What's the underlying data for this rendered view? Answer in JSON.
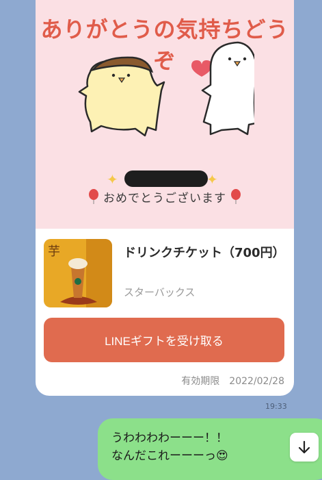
{
  "banner": {
    "title": "ありがとうの気持ちどうぞ",
    "congrats": "おめでとうございます"
  },
  "product": {
    "title": "ドリンクチケット（700円）",
    "brand": "スターバックス",
    "thumb_kanji": "芋"
  },
  "gift_button": {
    "label": "LINEギフトを受け取る"
  },
  "expiry": {
    "label": "有効期限",
    "date": "2022/02/28"
  },
  "chat": {
    "time": "19:33",
    "message_line1": "うわわわわーーー！！",
    "message_line2": "なんだこれーーーっ😍"
  },
  "colors": {
    "background": "#8ea9d0",
    "banner": "#fbe0e4",
    "button": "#e06b4f",
    "bubble": "#8ce08a"
  }
}
